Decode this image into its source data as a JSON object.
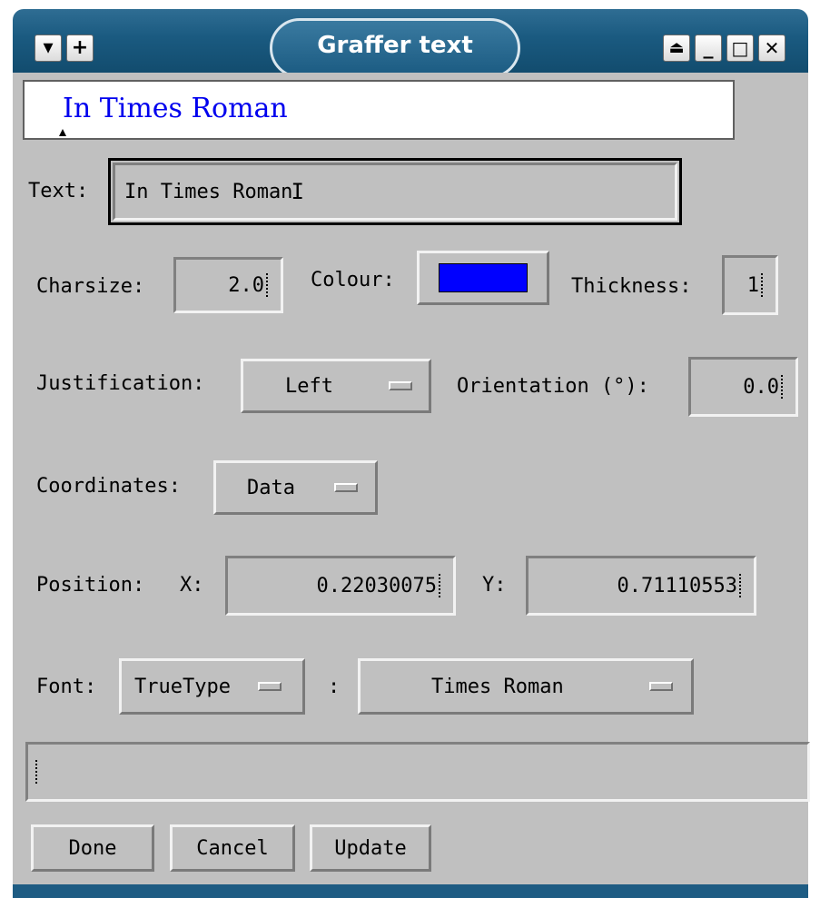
{
  "window": {
    "title": "Graffer text",
    "left_buttons": [
      "▾",
      "+"
    ],
    "right_buttons": [
      "⏏",
      "_",
      "□",
      "✕"
    ]
  },
  "preview": {
    "text": "In Times Roman",
    "color": "#0000ee"
  },
  "text_field": {
    "label": "Text:",
    "value": "In Times Roman"
  },
  "charsize": {
    "label": "Charsize:",
    "value": "2.0"
  },
  "colour": {
    "label": "Colour:",
    "swatch_color": "#0000ff"
  },
  "thickness": {
    "label": "Thickness:",
    "value": "1"
  },
  "justification": {
    "label": "Justification:",
    "value": "Left"
  },
  "orientation": {
    "label": "Orientation (°):",
    "value": "0.0"
  },
  "coordinates": {
    "label": "Coordinates:",
    "value": "Data"
  },
  "position": {
    "label": "Position:",
    "x_label": "X:",
    "x_value": "0.22030075",
    "y_label": "Y:",
    "y_value": "0.71110553"
  },
  "font": {
    "label": "Font:",
    "type_value": "TrueType",
    "separator": ":",
    "name_value": "Times Roman"
  },
  "status": {
    "value": ""
  },
  "buttons": {
    "done": "Done",
    "cancel": "Cancel",
    "update": "Update"
  },
  "colors": {
    "titlebar": "#1a5a80",
    "background": "#c0c0c0",
    "preview_text": "#0000ee",
    "swatch": "#0000ff"
  }
}
